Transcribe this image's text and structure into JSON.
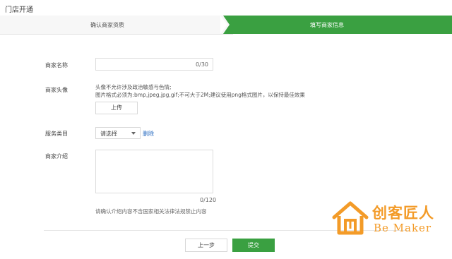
{
  "window": {
    "title": "门店开通"
  },
  "steps": [
    {
      "label": "确认商家资质",
      "active": false
    },
    {
      "label": "填写商家信息",
      "active": true
    }
  ],
  "form": {
    "name": {
      "label": "商家名称",
      "value": "",
      "counter": "0/30"
    },
    "avatar": {
      "label": "商家头像",
      "hint1": "头像不允许涉及政治敏感与色情;",
      "hint2": "图片格式必须为:bmp,jpeg,jpg,gif;不可大于2M;建议使用png格式图片，以保持最佳效果",
      "upload_label": "上传"
    },
    "category": {
      "label": "服务类目",
      "selected": "请选择",
      "delete_label": "删除"
    },
    "intro": {
      "label": "商家介绍",
      "value": "",
      "counter": "0/120",
      "note": "请确认介绍内容不含国家相关法律法规禁止内容"
    }
  },
  "footer": {
    "prev_label": "上一步",
    "submit_label": "提交"
  },
  "watermark": {
    "cn": "创客匠人",
    "en": "Be Maker"
  },
  "colors": {
    "accent": "#3aa041",
    "link": "#2a6dc2",
    "watermark": "#f39b28"
  }
}
